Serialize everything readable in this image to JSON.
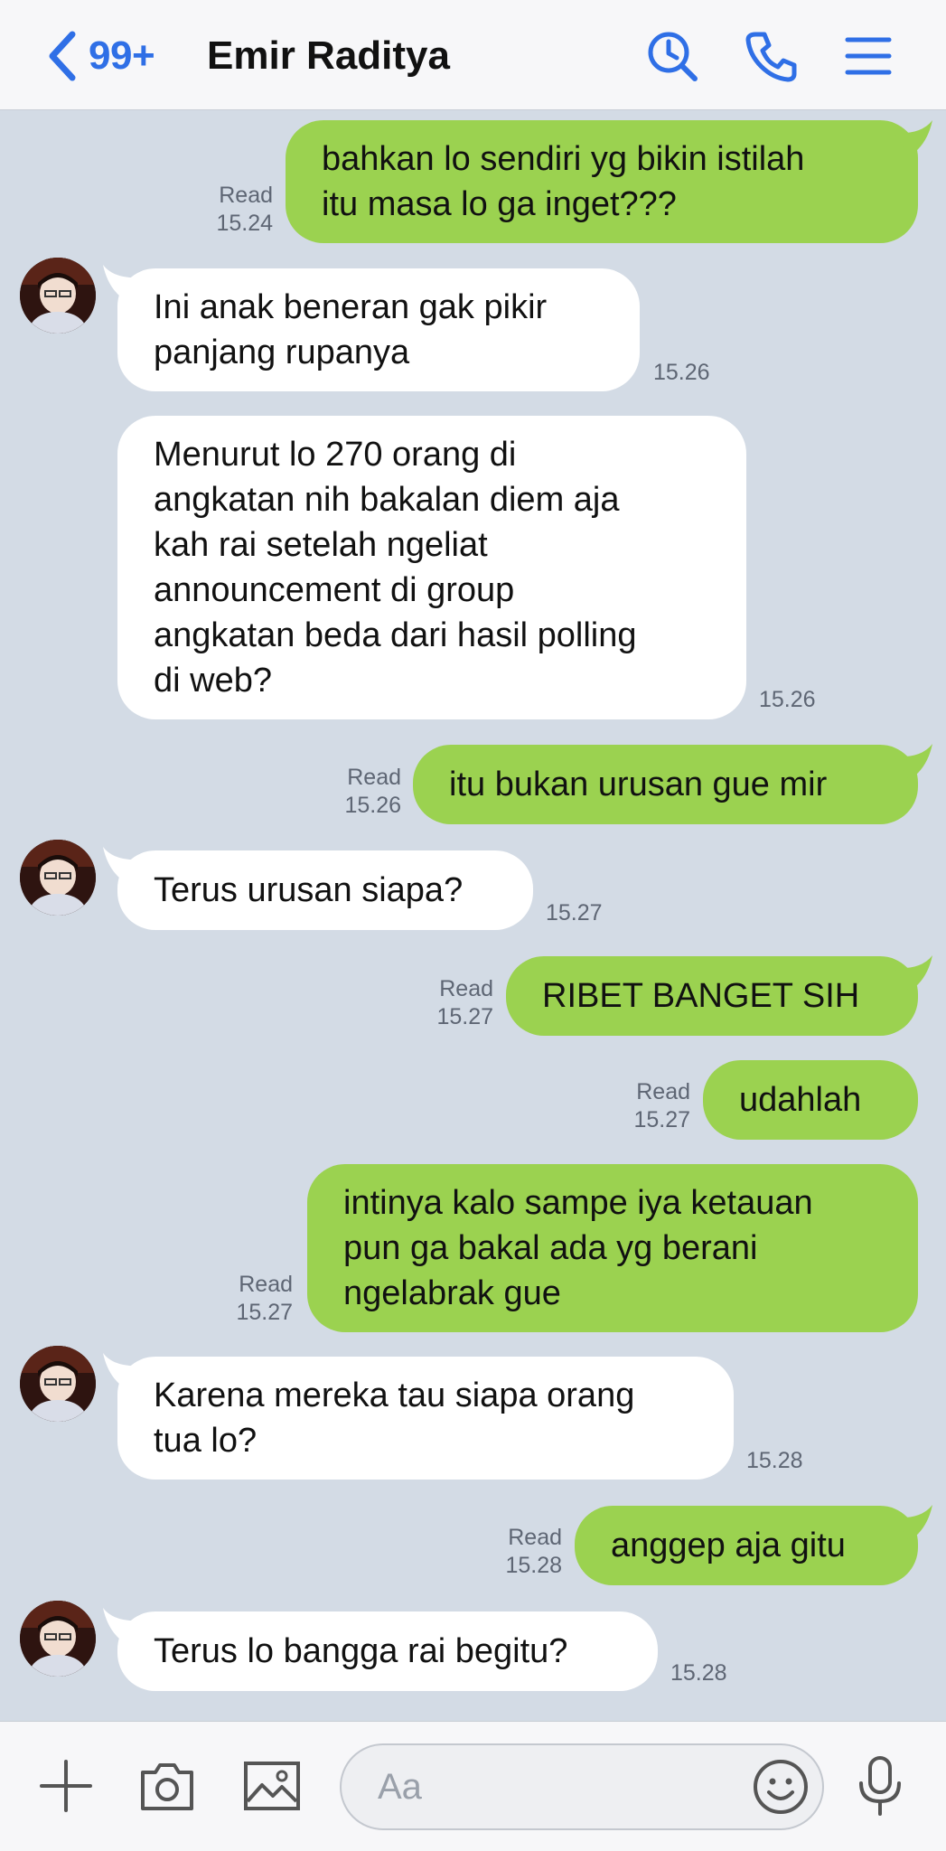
{
  "header": {
    "unread_count": "99+",
    "contact_name": "Emir Raditya",
    "icons": [
      "back-chevron-icon",
      "search-icon",
      "phone-icon",
      "menu-icon"
    ],
    "accent_color": "#2f6fe6"
  },
  "messages": [
    {
      "dir": "out",
      "text": "bahkan lo sendiri yg bikin istilah\nitu masa lo ga inget???",
      "status": "Read",
      "time": "15.24"
    },
    {
      "dir": "in",
      "text": "Ini anak beneran gak pikir\npanjang rupanya",
      "time": "15.26",
      "avatar": true
    },
    {
      "dir": "in",
      "text": "Menurut lo 270 orang di\nangkatan nih bakalan diem aja\nkah rai setelah ngeliat\nannouncement di group\nangkatan beda dari hasil polling\ndi web?",
      "time": "15.26",
      "avatar": false
    },
    {
      "dir": "out",
      "text": "itu bukan urusan gue mir",
      "status": "Read",
      "time": "15.26"
    },
    {
      "dir": "in",
      "text": "Terus urusan siapa?",
      "time": "15.27",
      "avatar": true
    },
    {
      "dir": "out",
      "text": "RIBET BANGET SIH",
      "status": "Read",
      "time": "15.27"
    },
    {
      "dir": "out",
      "text": "udahlah",
      "status": "Read",
      "time": "15.27"
    },
    {
      "dir": "out",
      "text": "intinya kalo sampe iya ketauan\npun ga bakal ada yg berani\nngelabrak gue",
      "status": "Read",
      "time": "15.27"
    },
    {
      "dir": "in",
      "text": "Karena mereka tau siapa orang\ntua lo?",
      "time": "15.28",
      "avatar": true
    },
    {
      "dir": "out",
      "text": "anggep aja gitu",
      "status": "Read",
      "time": "15.28"
    },
    {
      "dir": "in",
      "text": "Terus lo bangga rai begitu?",
      "time": "15.28",
      "avatar": true
    }
  ],
  "composer": {
    "placeholder": "Aa",
    "icons": [
      "plus-icon",
      "camera-icon",
      "image-icon",
      "emoji-icon",
      "microphone-icon"
    ]
  },
  "colors": {
    "background": "#d3dbe5",
    "outgoing_bubble": "#9bd250",
    "incoming_bubble": "#ffffff"
  }
}
